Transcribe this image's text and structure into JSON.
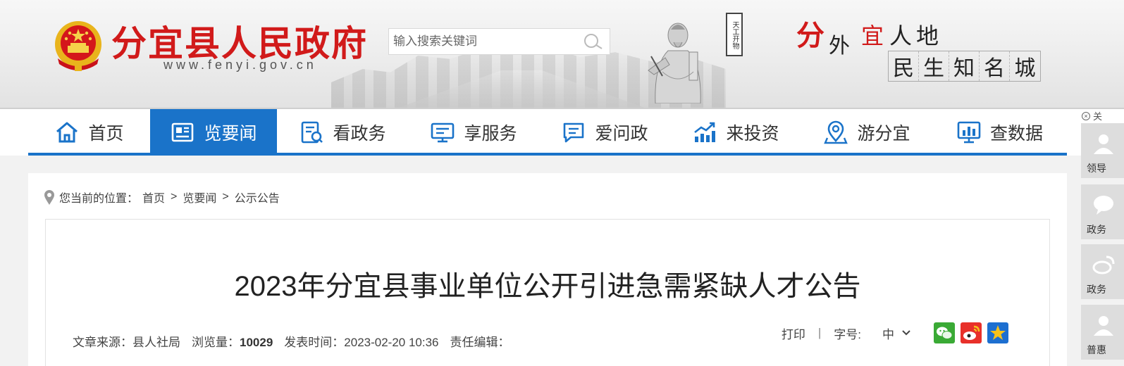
{
  "header": {
    "site_title": "分宜县人民政府",
    "site_url": "www.fenyi.gov.cn",
    "search_placeholder": "输入搜索关键词",
    "seal_text": "天工开物",
    "slogan": {
      "fen": "分",
      "wai": "外",
      "yi": "宜",
      "rendi": "人地",
      "grid": [
        "民",
        "生",
        "知",
        "名",
        "城"
      ]
    }
  },
  "nav": {
    "items": [
      {
        "label": "首页",
        "icon": "home-icon"
      },
      {
        "label": "览要闻",
        "icon": "newspaper-icon",
        "active": true
      },
      {
        "label": "看政务",
        "icon": "document-search-icon"
      },
      {
        "label": "享服务",
        "icon": "monitor-icon"
      },
      {
        "label": "爱问政",
        "icon": "chat-icon"
      },
      {
        "label": "来投资",
        "icon": "growth-chart-icon"
      },
      {
        "label": "游分宜",
        "icon": "map-pin-icon"
      },
      {
        "label": "查数据",
        "icon": "data-chart-icon"
      }
    ],
    "accent_color": "#1a73c9"
  },
  "right_float": {
    "close_label": "关",
    "items": [
      "领导",
      "政务",
      "政务",
      "普惠"
    ]
  },
  "breadcrumb": {
    "prefix": "您当前的位置：",
    "items": [
      "首页",
      "览要闻",
      "公示公告"
    ],
    "separator": ">"
  },
  "article": {
    "title": "2023年分宜县事业单位公开引进急需紧缺人才公告",
    "source_label": "文章来源：",
    "source_value": "县人社局",
    "views_label": "浏览量：",
    "views_value": "10029",
    "time_label": "发表时间：",
    "time_value": "2023-02-20 10:36",
    "editor_label": "责任编辑："
  },
  "tools": {
    "print_label": "打印",
    "pipe": "|",
    "fontsize_label": "字号:",
    "fontsize_value": "中",
    "share_icons": [
      "wechat-icon",
      "weibo-icon",
      "favorite-star-icon"
    ]
  }
}
